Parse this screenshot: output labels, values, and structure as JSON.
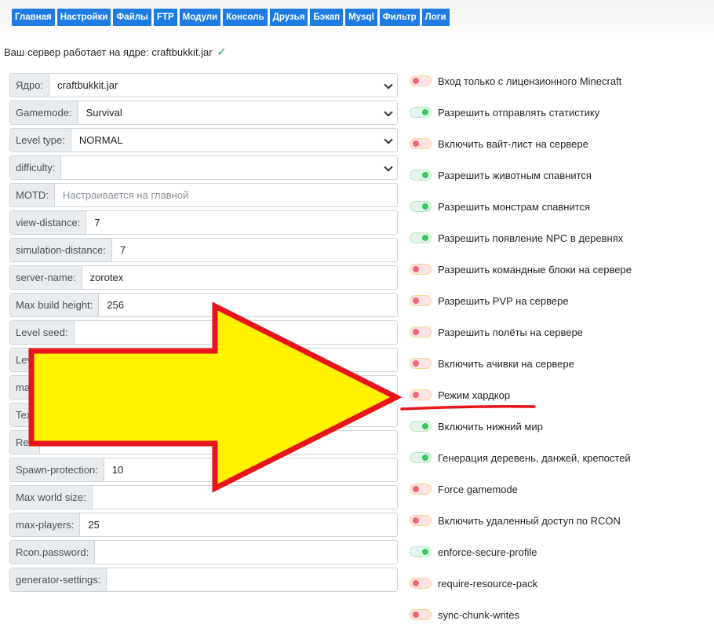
{
  "nav": [
    "Главная",
    "Настройки",
    "Файлы",
    "FTP",
    "Модули",
    "Консоль",
    "Друзья",
    "Бэкап",
    "Mysql",
    "Фильтр",
    "Логи"
  ],
  "kernel_text": "Ваш сервер работает на ядре: craftbukkit.jar",
  "check_glyph": "✓",
  "fields": [
    {
      "label": "Ядро:",
      "value": "craftbukkit.jar",
      "type": "select"
    },
    {
      "label": "Gamemode:",
      "value": "Survival",
      "type": "select"
    },
    {
      "label": "Level type:",
      "value": "NORMAL",
      "type": "select"
    },
    {
      "label": "difficulty:",
      "value": "",
      "type": "select"
    },
    {
      "label": "MOTD:",
      "value": "",
      "placeholder": "Настраивается на главной",
      "type": "input"
    },
    {
      "label": "view-distance:",
      "value": "7",
      "type": "input"
    },
    {
      "label": "simulation-distance:",
      "value": "7",
      "type": "input"
    },
    {
      "label": "server-name:",
      "value": "zorotex",
      "type": "input"
    },
    {
      "label": "Max build height:",
      "value": "256",
      "type": "input"
    },
    {
      "label": "Level seed:",
      "value": "",
      "type": "input"
    },
    {
      "label": "Lev",
      "value": "",
      "type": "input"
    },
    {
      "label": "ma",
      "value": "",
      "type": "input"
    },
    {
      "label": "Tex",
      "value": "",
      "type": "input"
    },
    {
      "label": "Res",
      "value": "",
      "type": "input"
    },
    {
      "label": "Spawn-protection:",
      "value": "10",
      "type": "input"
    },
    {
      "label": "Max world size:",
      "value": "",
      "type": "input"
    },
    {
      "label": "max-players:",
      "value": "25",
      "type": "input"
    },
    {
      "label": "Rcon.password:",
      "value": "",
      "type": "input"
    },
    {
      "label": "generator-settings:",
      "value": "",
      "type": "input"
    }
  ],
  "toggles": [
    {
      "label": "Вход только с лицензионного Minecraft",
      "on": false
    },
    {
      "label": "Разрешить отправлять статистику",
      "on": true
    },
    {
      "label": "Включить вайт-лист на сервере",
      "on": false
    },
    {
      "label": "Разрешить животным спавнится",
      "on": true
    },
    {
      "label": "Разрешить монстрам спавнится",
      "on": true
    },
    {
      "label": "Разрешить появление NPC в деревнях",
      "on": true
    },
    {
      "label": "Разрешить командные блоки на сервере",
      "on": false
    },
    {
      "label": "Разрешить PVP на сервере",
      "on": false
    },
    {
      "label": "Разрешить полёты на сервере",
      "on": false
    },
    {
      "label": "Включить ачивки на сервере",
      "on": false
    },
    {
      "label": "Режим хардкор",
      "on": false
    },
    {
      "label": "Включить нижний мир",
      "on": true
    },
    {
      "label": "Генерация деревень, данжей, крепостей",
      "on": true
    },
    {
      "label": "Force gamemode",
      "on": false
    },
    {
      "label": "Включить удаленный доступ по RCON",
      "on": false
    },
    {
      "label": "enforce-secure-profile",
      "on": true
    },
    {
      "label": "require-resource-pack",
      "on": false
    },
    {
      "label": "sync-chunk-writes",
      "on": false
    }
  ],
  "colors": {
    "nav_bg": "#1e7be2",
    "arrow_fill": "#fff200",
    "arrow_stroke": "#e8141b",
    "toggle_on": "#40c463",
    "toggle_off": "#ef6678"
  }
}
